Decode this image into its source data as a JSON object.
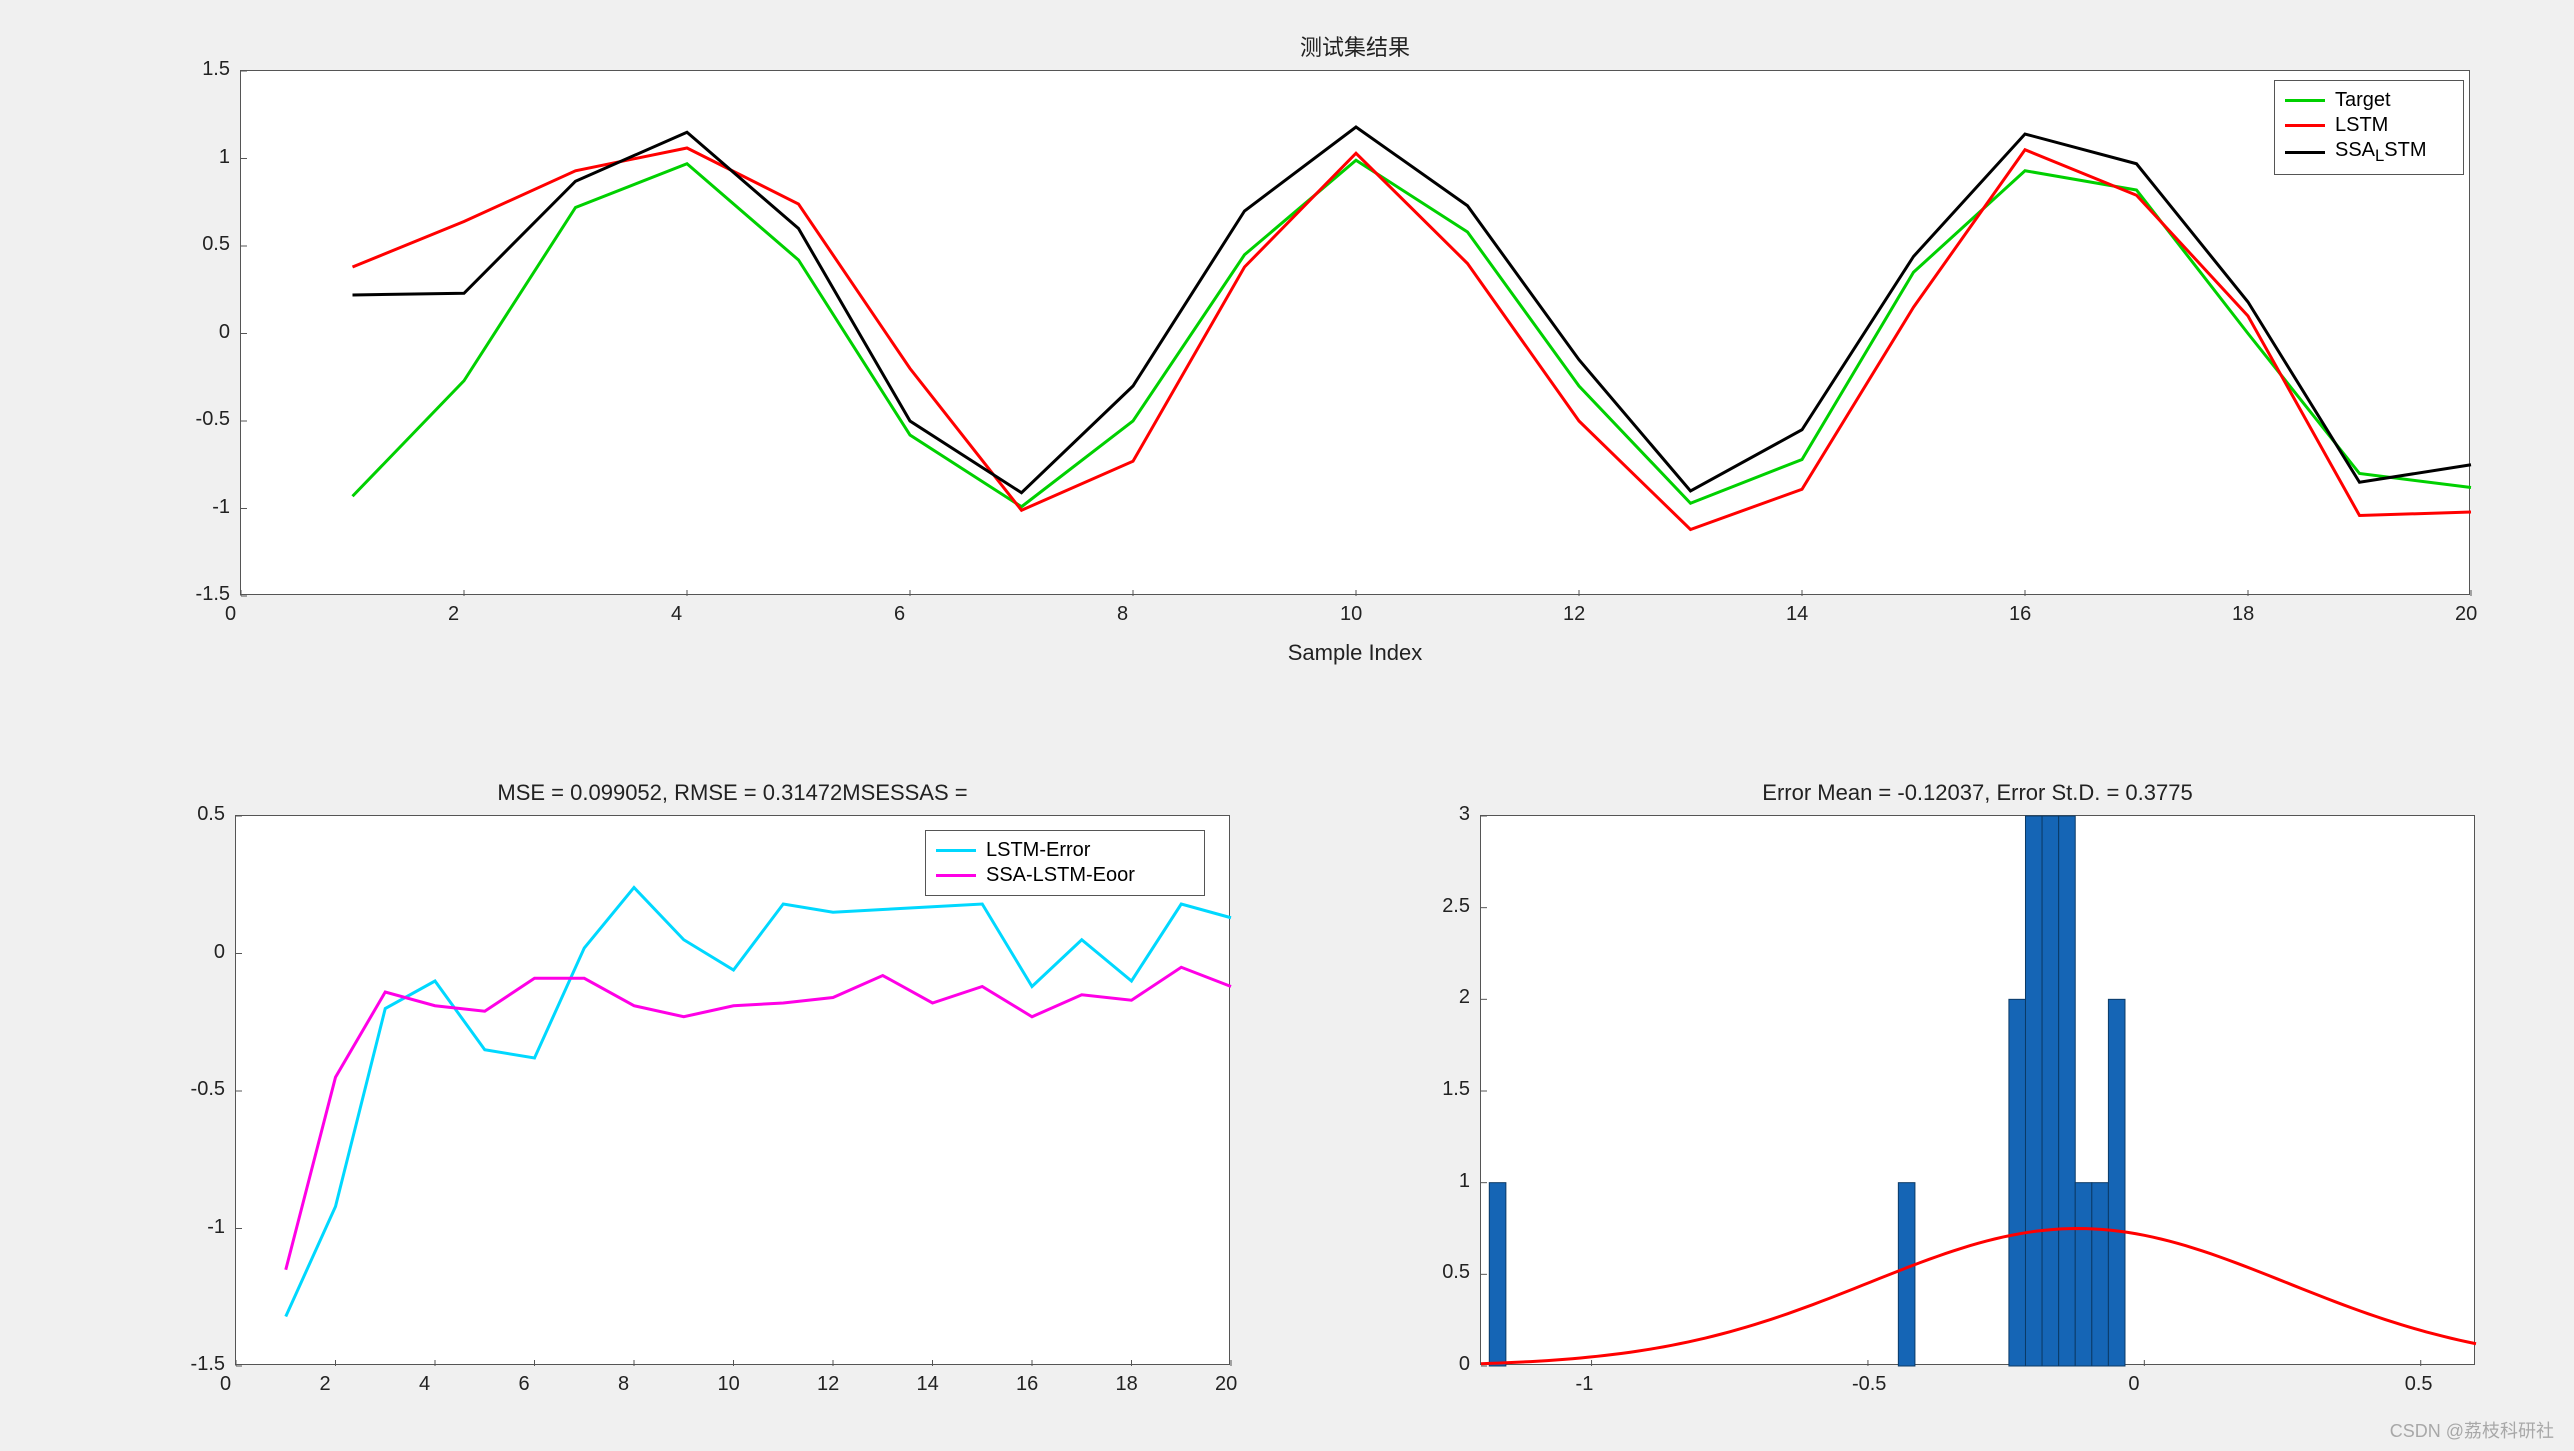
{
  "watermark": "CSDN @荔枝科研社",
  "chart_data": [
    {
      "id": "top",
      "type": "line",
      "title": "测试集结果",
      "xlabel": "Sample Index",
      "ylabel": "",
      "xlim": [
        0,
        20
      ],
      "ylim": [
        -1.5,
        1.5
      ],
      "xticks": [
        0,
        2,
        4,
        6,
        8,
        10,
        12,
        14,
        16,
        18,
        20
      ],
      "yticks": [
        -1.5,
        -1,
        -0.5,
        0,
        0.5,
        1,
        1.5
      ],
      "series": [
        {
          "name": "Target",
          "color": "#00d000",
          "x": [
            1,
            2,
            3,
            4,
            5,
            6,
            7,
            8,
            9,
            10,
            11,
            12,
            13,
            14,
            15,
            16,
            17,
            18,
            19,
            20
          ],
          "values": [
            -0.93,
            -0.27,
            0.72,
            0.97,
            0.42,
            -0.58,
            -0.99,
            -0.5,
            0.45,
            0.99,
            0.58,
            -0.3,
            -0.97,
            -0.72,
            0.35,
            0.93,
            0.82,
            0.0,
            -0.8,
            -0.88
          ]
        },
        {
          "name": "LSTM",
          "color": "#ff0000",
          "x": [
            1,
            2,
            3,
            4,
            5,
            6,
            7,
            8,
            9,
            10,
            11,
            12,
            13,
            14,
            15,
            16,
            17,
            18,
            19,
            20
          ],
          "values": [
            0.38,
            0.64,
            0.93,
            1.06,
            0.74,
            -0.2,
            -1.01,
            -0.73,
            0.38,
            1.03,
            0.4,
            -0.5,
            -1.12,
            -0.89,
            0.15,
            1.05,
            0.79,
            0.1,
            -1.04,
            -1.02
          ]
        },
        {
          "name": "SSA_LSTM",
          "color": "#000000",
          "sub": "L",
          "x": [
            1,
            2,
            3,
            4,
            5,
            6,
            7,
            8,
            9,
            10,
            11,
            12,
            13,
            14,
            15,
            16,
            17,
            18,
            19,
            20
          ],
          "values": [
            0.22,
            0.23,
            0.87,
            1.15,
            0.6,
            -0.5,
            -0.91,
            -0.3,
            0.7,
            1.18,
            0.73,
            -0.15,
            -0.9,
            -0.55,
            0.44,
            1.14,
            0.97,
            0.18,
            -0.85,
            -0.75
          ]
        }
      ]
    },
    {
      "id": "bottom-left",
      "type": "line",
      "title": "MSE = 0.099052, RMSE = 0.31472MSESSAS =",
      "xlabel": "",
      "ylabel": "",
      "xlim": [
        0,
        20
      ],
      "ylim": [
        -1.5,
        0.5
      ],
      "xticks": [
        0,
        2,
        4,
        6,
        8,
        10,
        12,
        14,
        16,
        18,
        20
      ],
      "yticks": [
        -1.5,
        -1,
        -0.5,
        0,
        0.5
      ],
      "series": [
        {
          "name": "LSTM-Error",
          "color": "#00d8ff",
          "x": [
            1,
            2,
            3,
            4,
            5,
            6,
            7,
            8,
            9,
            10,
            11,
            12,
            13,
            14,
            15,
            16,
            17,
            18,
            19,
            20
          ],
          "values": [
            -1.32,
            -0.92,
            -0.2,
            -0.1,
            -0.35,
            -0.38,
            0.02,
            0.24,
            0.05,
            -0.06,
            0.18,
            0.15,
            0.16,
            0.17,
            0.18,
            -0.12,
            0.05,
            -0.1,
            0.18,
            0.13
          ]
        },
        {
          "name": "SSA-LSTM-Eoor",
          "color": "#ff00e6",
          "x": [
            1,
            2,
            3,
            4,
            5,
            6,
            7,
            8,
            9,
            10,
            11,
            12,
            13,
            14,
            15,
            16,
            17,
            18,
            19,
            20
          ],
          "values": [
            -1.15,
            -0.45,
            -0.14,
            -0.19,
            -0.21,
            -0.09,
            -0.09,
            -0.19,
            -0.23,
            -0.19,
            -0.18,
            -0.16,
            -0.08,
            -0.18,
            -0.12,
            -0.23,
            -0.15,
            -0.17,
            -0.05,
            -0.12
          ]
        }
      ]
    },
    {
      "id": "bottom-right",
      "type": "histogram",
      "title": "Error Mean = -0.12037, Error St.D. = 0.3775",
      "xlabel": "",
      "ylabel": "",
      "xlim": [
        -1.2,
        0.6
      ],
      "ylim": [
        0,
        3
      ],
      "xticks": [
        -1,
        -0.5,
        0,
        0.5
      ],
      "yticks": [
        0,
        0.5,
        1,
        1.5,
        2,
        2.5,
        3
      ],
      "bins": [
        {
          "x": -1.17,
          "count": 1
        },
        {
          "x": -0.43,
          "count": 1
        },
        {
          "x": -0.23,
          "count": 2
        },
        {
          "x": -0.2,
          "count": 3
        },
        {
          "x": -0.17,
          "count": 3
        },
        {
          "x": -0.14,
          "count": 3
        },
        {
          "x": -0.11,
          "count": 1
        },
        {
          "x": -0.08,
          "count": 1
        },
        {
          "x": -0.05,
          "count": 2
        }
      ],
      "bin_width": 0.03,
      "curve": {
        "color": "#ff0000",
        "mean": -0.12037,
        "std": 0.3775,
        "scale": 0.75
      }
    }
  ]
}
